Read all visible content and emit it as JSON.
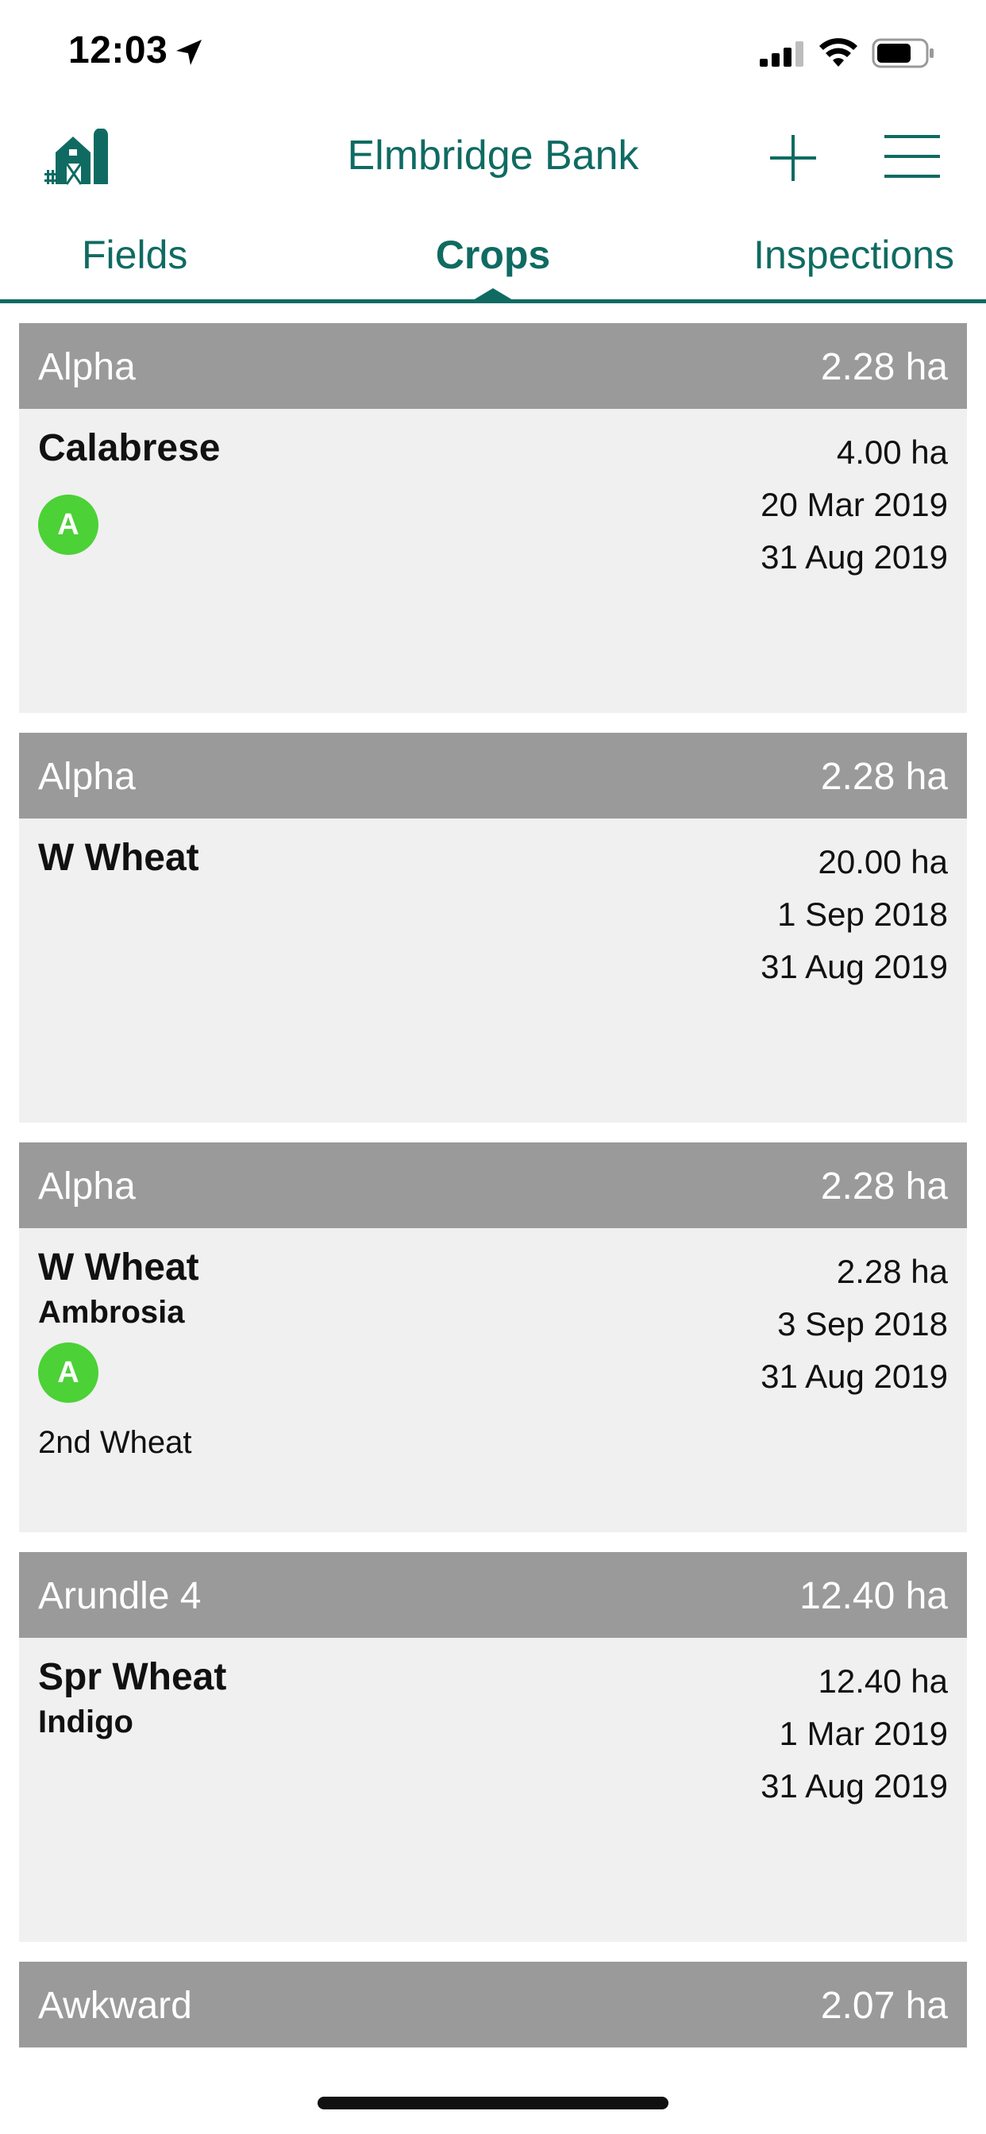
{
  "status_bar": {
    "time": "12:03",
    "icons": [
      "location-arrow-icon",
      "signal-icon",
      "wifi-icon",
      "battery-icon"
    ]
  },
  "header": {
    "title": "Elmbridge Bank",
    "logo_icon": "farm-icon",
    "add_icon": "plus-icon",
    "menu_icon": "hamburger-menu-icon"
  },
  "tabs": [
    {
      "label": "Fields",
      "selected": false
    },
    {
      "label": "Crops",
      "selected": true
    },
    {
      "label": "Inspections",
      "selected": false
    }
  ],
  "colors": {
    "brand": "#0f6b62",
    "card_header": "#9a9a9a",
    "card_body": "#f0f0f0",
    "badge": "#4cd137"
  },
  "crops": [
    {
      "field": "Alpha",
      "field_area": "2.28 ha",
      "crop": "Calabrese",
      "variety": "",
      "badge": "A",
      "note": "",
      "crop_area": "4.00 ha",
      "start_date": "20 Mar 2019",
      "end_date": "31 Aug 2019"
    },
    {
      "field": "Alpha",
      "field_area": "2.28 ha",
      "crop": "W Wheat",
      "variety": "",
      "badge": "",
      "note": "",
      "crop_area": "20.00 ha",
      "start_date": "1 Sep 2018",
      "end_date": "31 Aug 2019"
    },
    {
      "field": "Alpha",
      "field_area": "2.28 ha",
      "crop": "W Wheat",
      "variety": "Ambrosia",
      "badge": "A",
      "note": "2nd Wheat",
      "crop_area": "2.28 ha",
      "start_date": "3 Sep 2018",
      "end_date": "31 Aug 2019"
    },
    {
      "field": "Arundle 4",
      "field_area": "12.40 ha",
      "crop": "Spr Wheat",
      "variety": "Indigo",
      "badge": "",
      "note": "",
      "crop_area": "12.40 ha",
      "start_date": "1 Mar 2019",
      "end_date": "31 Aug 2019"
    },
    {
      "field": "Awkward",
      "field_area": "2.07 ha"
    }
  ]
}
